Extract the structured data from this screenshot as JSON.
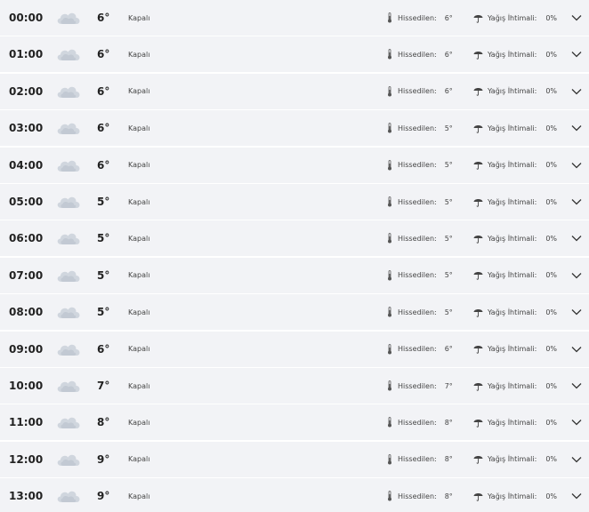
{
  "feels_label": "Hissedilen:",
  "rain_label": "Yağış İhtimali:",
  "icons": {
    "condition": "cloud-icon",
    "feels": "thermometer-icon",
    "rain": "umbrella-icon",
    "expand": "chevron-down-icon"
  },
  "colors": {
    "row_background": "#f2f3f6",
    "cloud": "#d0d6de",
    "text": "#222222"
  },
  "hours": [
    {
      "time": "00:00",
      "temp": "6°",
      "condition": "Kapalı",
      "feels": "6°",
      "rain": "0%"
    },
    {
      "time": "01:00",
      "temp": "6°",
      "condition": "Kapalı",
      "feels": "6°",
      "rain": "0%"
    },
    {
      "time": "02:00",
      "temp": "6°",
      "condition": "Kapalı",
      "feels": "6°",
      "rain": "0%"
    },
    {
      "time": "03:00",
      "temp": "6°",
      "condition": "Kapalı",
      "feels": "5°",
      "rain": "0%"
    },
    {
      "time": "04:00",
      "temp": "6°",
      "condition": "Kapalı",
      "feels": "5°",
      "rain": "0%"
    },
    {
      "time": "05:00",
      "temp": "5°",
      "condition": "Kapalı",
      "feels": "5°",
      "rain": "0%"
    },
    {
      "time": "06:00",
      "temp": "5°",
      "condition": "Kapalı",
      "feels": "5°",
      "rain": "0%"
    },
    {
      "time": "07:00",
      "temp": "5°",
      "condition": "Kapalı",
      "feels": "5°",
      "rain": "0%"
    },
    {
      "time": "08:00",
      "temp": "5°",
      "condition": "Kapalı",
      "feels": "5°",
      "rain": "0%"
    },
    {
      "time": "09:00",
      "temp": "6°",
      "condition": "Kapalı",
      "feels": "6°",
      "rain": "0%"
    },
    {
      "time": "10:00",
      "temp": "7°",
      "condition": "Kapalı",
      "feels": "7°",
      "rain": "0%"
    },
    {
      "time": "11:00",
      "temp": "8°",
      "condition": "Kapalı",
      "feels": "8°",
      "rain": "0%"
    },
    {
      "time": "12:00",
      "temp": "9°",
      "condition": "Kapalı",
      "feels": "8°",
      "rain": "0%"
    },
    {
      "time": "13:00",
      "temp": "9°",
      "condition": "Kapalı",
      "feels": "8°",
      "rain": "0%"
    }
  ]
}
